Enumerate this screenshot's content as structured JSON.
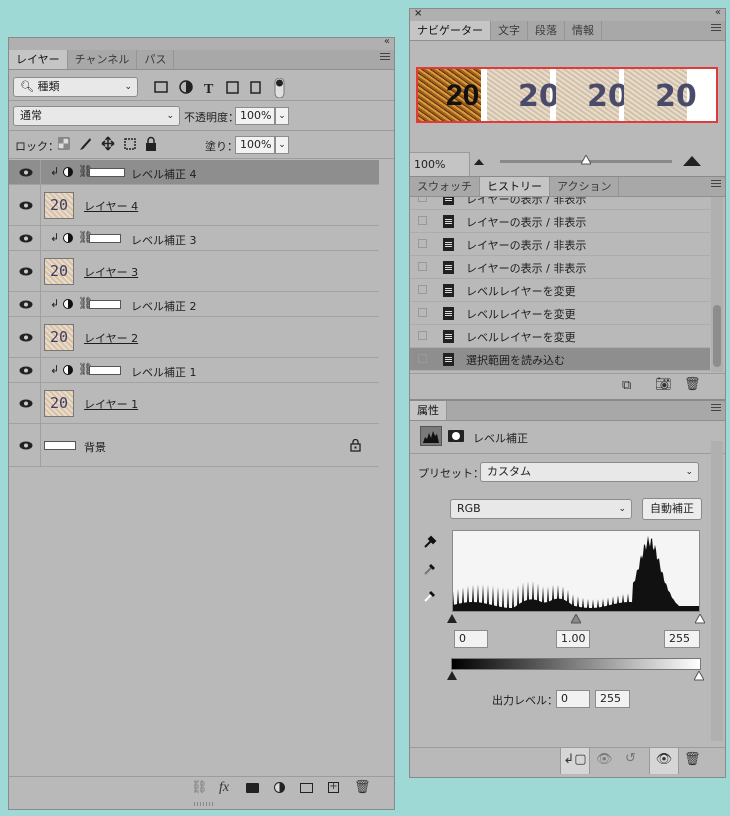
{
  "layers_panel": {
    "tabs": [
      "レイヤー",
      "チャンネル",
      "パス"
    ],
    "filter_kind": "種類",
    "blend_mode": "通常",
    "opacity_label": "不透明度：",
    "opacity_value": "100%",
    "lock_label": "ロック：",
    "fill_label": "塗り：",
    "fill_value": "100%",
    "layers": [
      {
        "name": "レベル補正 4",
        "kind": "adjustment",
        "selected": true
      },
      {
        "name": "レイヤー 4",
        "kind": "pixel",
        "thumb_text": "20"
      },
      {
        "name": "レベル補正 3",
        "kind": "adjustment"
      },
      {
        "name": "レイヤー 3",
        "kind": "pixel",
        "thumb_text": "20"
      },
      {
        "name": "レベル補正 2",
        "kind": "adjustment"
      },
      {
        "name": "レイヤー 2",
        "kind": "pixel",
        "thumb_text": "20"
      },
      {
        "name": "レベル補正 1",
        "kind": "adjustment"
      },
      {
        "name": "レイヤー 1",
        "kind": "pixel",
        "thumb_text": "20"
      },
      {
        "name": "背景",
        "kind": "background"
      }
    ]
  },
  "navigator_panel": {
    "tabs": [
      "ナビゲーター",
      "文字",
      "段落",
      "情報"
    ],
    "preview_texts": [
      "20",
      "20",
      "20",
      "20"
    ],
    "zoom": "100%",
    "slider_fraction": 0.5
  },
  "history_panel": {
    "tabs": [
      "スウォッチ",
      "ヒストリー",
      "アクション"
    ],
    "items": [
      {
        "label": "レイヤーの表示 / 非表示"
      },
      {
        "label": "レイヤーの表示 / 非表示"
      },
      {
        "label": "レイヤーの表示 / 非表示"
      },
      {
        "label": "レイヤーの表示 / 非表示"
      },
      {
        "label": "レベルレイヤーを変更"
      },
      {
        "label": "レベルレイヤーを変更"
      },
      {
        "label": "レベルレイヤーを変更"
      },
      {
        "label": "選択範囲を読み込む",
        "selected": true
      }
    ]
  },
  "properties_panel": {
    "tab": "属性",
    "type_label": "レベル補正",
    "preset_label": "プリセット：",
    "preset_value": "カスタム",
    "channel_value": "RGB",
    "auto_button": "自動補正",
    "input_black": "0",
    "input_gamma": "1.00",
    "input_white": "255",
    "output_label": "出力レベル：",
    "output_black": "0",
    "output_white": "255"
  },
  "colors": {
    "background": "#9fd9d6",
    "panel": "#b9b9b9",
    "selected_row": "#8e8e8e",
    "nav_frame": "#e03a3a"
  }
}
